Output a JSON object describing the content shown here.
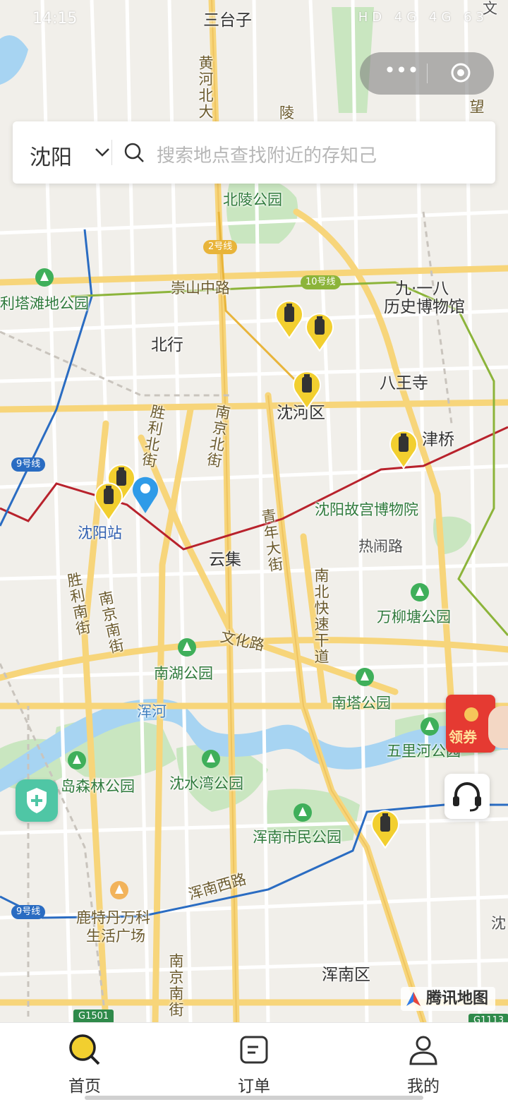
{
  "status_bar": {
    "time": "14:15",
    "icons": "HD 4G 4G 63"
  },
  "capsule": {
    "more": "•••"
  },
  "search": {
    "city": "沈阳",
    "placeholder": "搜索地点查找附近的存知己"
  },
  "map": {
    "labels": {
      "santaizi": "三台子",
      "huanghebeidajie": "黄河北大",
      "beilingpark": "北陵公园",
      "chongshanzhonglu": "崇山中路",
      "litatanpark": "利塔滩地公园",
      "museum918_a": "九·一八",
      "museum918_b": "历史博物馆",
      "beihang": "北行",
      "bawangsi": "八王寺",
      "shenhequ": "沈河区",
      "jinqiao": "津桥",
      "nanjingbeijie": "南京北街",
      "shenglibeijie": "胜利北街",
      "shenyangzhan": "沈阳站",
      "gugong": "沈阳故宫博物院",
      "qingniandajie": "青年大街",
      "yunji": "云集",
      "renaolu": "热闹路",
      "shenglinanjie": "胜利南街",
      "nanjingnanjie": "南京南街",
      "nanbeikuaisu": "南北快速干道",
      "wanliutangpark": "万柳塘公园",
      "wenhualu": "文化路",
      "nanhupark": "南湖公园",
      "huner": "浑河",
      "nantapark": "南塔公园",
      "wulihepark": "五里河公园",
      "daosenlinpark": "岛森林公园",
      "shenshuiwanpark": "沈水湾公园",
      "hunnanshiminpark": "浑南市民公园",
      "hunnanxilu": "浑南西路",
      "wanke_a": "鹿特丹万科",
      "wanke_b": "生活广场",
      "nanjingnanjie2": "南京南街",
      "hunnanqu": "浑南区",
      "shen_edge": "沈",
      "wang_edge": "望",
      "wen_edge": "文",
      "ling_edge": "陵"
    },
    "badges": {
      "line9_a": "9号线",
      "line9_b": "9号线",
      "line2": "2号线",
      "line10": "10号线",
      "g1501": "G1501",
      "g1113": "G1113"
    },
    "locker_pins": 7,
    "colors": {
      "line1": "#b8222c",
      "line9": "#2a6cc2",
      "line10": "#8cb43a",
      "road_main": "#f7d57a",
      "park": "#c9e6c0",
      "water": "#a7d4f2",
      "pin_yellow": "#f2cf2f"
    }
  },
  "coupon": {
    "label": "领券"
  },
  "brand": {
    "label": "腾讯地图"
  },
  "tabs": [
    {
      "label": "首页",
      "icon": "search-icon"
    },
    {
      "label": "订单",
      "icon": "order-icon"
    },
    {
      "label": "我的",
      "icon": "user-icon"
    }
  ]
}
